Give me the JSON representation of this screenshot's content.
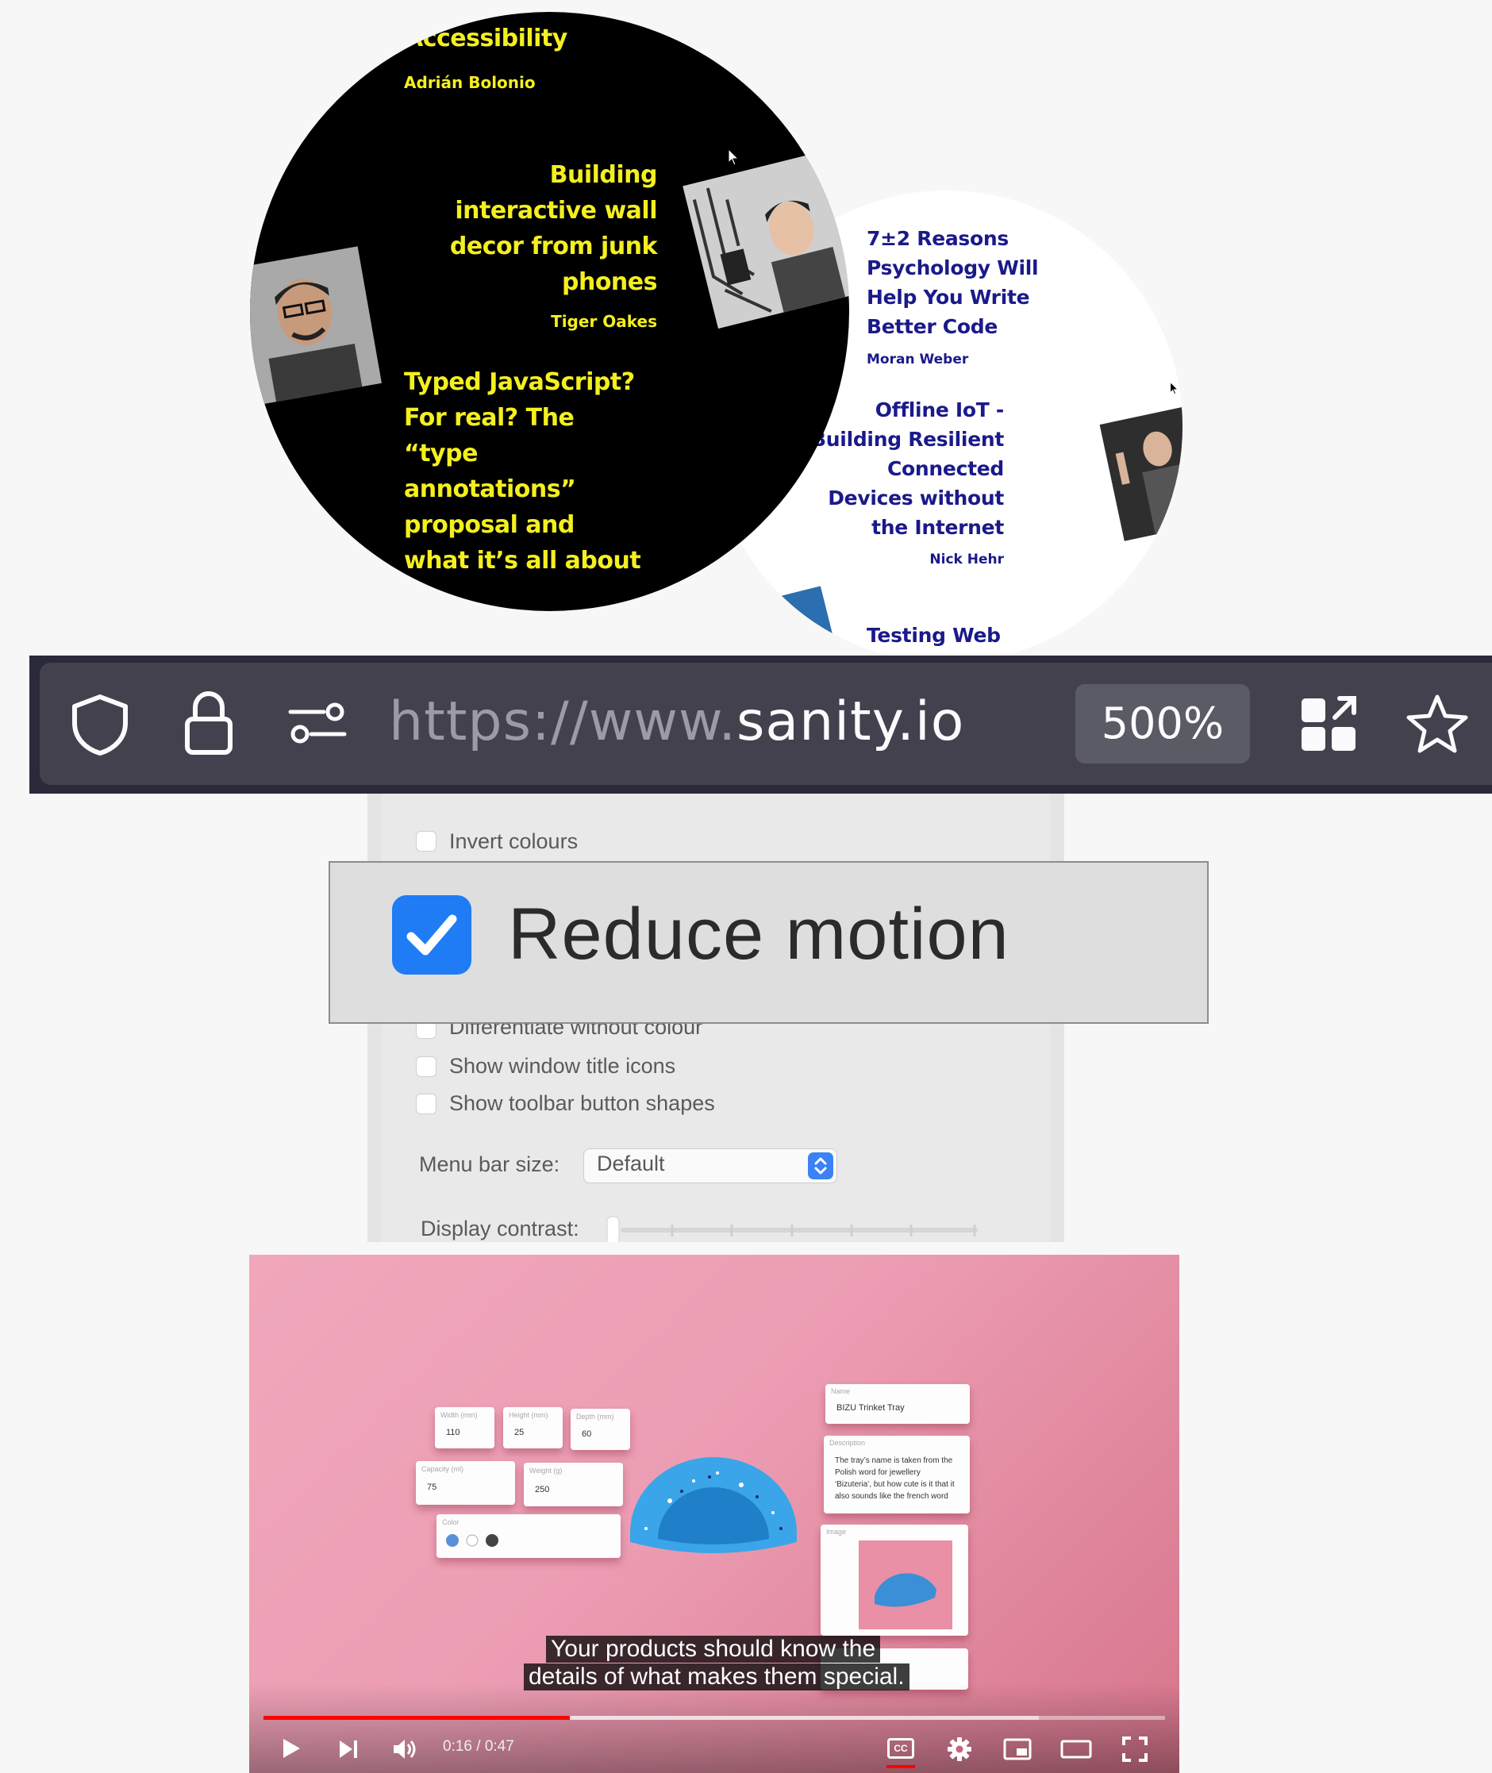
{
  "talks": {
    "accessibility": {
      "title": "Accessibility",
      "speaker": "Adrián Bolonio"
    },
    "wall_decor": {
      "title_lines": [
        "Building",
        "interactive wall",
        "decor from junk",
        "phones"
      ],
      "speaker": "Tiger Oakes"
    },
    "typed_js": {
      "title_lines": [
        "Typed JavaScript?",
        "For real? The",
        "“type",
        "annotations”",
        "proposal and",
        "what it’s all about"
      ]
    },
    "psychology": {
      "title_lines": [
        "7±2 Reasons",
        "Psychology Will",
        "Help You Write",
        "Better Code"
      ],
      "speaker": "Moran Weber"
    },
    "offline_iot": {
      "title_lines": [
        "Offline IoT -",
        "Building Resilient",
        "Connected",
        "Devices without",
        "the Internet"
      ],
      "speaker": "Nick Hehr"
    },
    "testing": {
      "title": "Testing Web"
    }
  },
  "browser": {
    "url_scheme": "https://www.",
    "url_host": "sanity.io",
    "zoom": "500%",
    "icons": [
      "shield-icon",
      "lock-icon",
      "permissions-icon",
      "extensions-icon",
      "star-icon"
    ]
  },
  "accessibility_panel": {
    "invert_colours": {
      "label": "Invert colours",
      "checked": false
    },
    "reduce_motion": {
      "label": "Reduce motion",
      "checked": true
    },
    "differentiate": {
      "label": "Differentiate without colour",
      "checked": false
    },
    "title_icons": {
      "label": "Show window title icons",
      "checked": false
    },
    "toolbar_shapes": {
      "label": "Show toolbar button shapes",
      "checked": false
    },
    "menu_bar_size": {
      "label": "Menu bar size:",
      "value": "Default"
    },
    "display_contrast": {
      "label": "Display contrast:",
      "value": 0
    }
  },
  "video": {
    "fields": {
      "width": {
        "label": "Width (mm)",
        "value": "110"
      },
      "height": {
        "label": "Height (mm)",
        "value": "25"
      },
      "depth": {
        "label": "Depth (mm)",
        "value": "60"
      },
      "capacity": {
        "label": "Capacity (ml)",
        "value": "75"
      },
      "weight": {
        "label": "Weight (g)",
        "value": "250"
      },
      "color": {
        "label": "Color"
      },
      "name": {
        "label": "Name",
        "value": "BIZU Trinket Tray"
      },
      "description": {
        "label": "Description",
        "value_lines": [
          "The tray’s name is taken from the",
          "Polish word for jewellery",
          "‘Bizuteria’, but how cute is it that it",
          "also sounds like the french word"
        ]
      },
      "image": {
        "label": "Image"
      }
    },
    "swatch_colors": [
      "#5b8fd8",
      "#ffffff",
      "#444444"
    ],
    "caption_lines": [
      "Your products should know the",
      "details of what makes them special."
    ],
    "current_time": "0:16",
    "duration": "0:47",
    "progress": 0.34,
    "buffered": 0.86,
    "cc_label": "CC"
  }
}
